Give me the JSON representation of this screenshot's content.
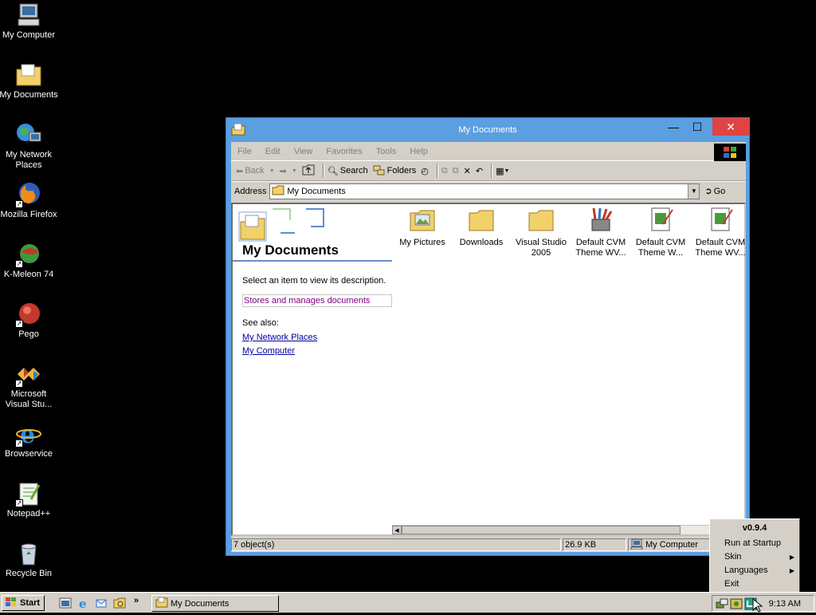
{
  "desktop": {
    "icons": [
      {
        "label": "My Computer",
        "icon": "computer-icon"
      },
      {
        "label": "My Documents",
        "icon": "documents-folder-icon"
      },
      {
        "label": "My Network\nPlaces",
        "icon": "network-places-icon"
      },
      {
        "label": "Mozilla Firefox",
        "icon": "firefox-icon"
      },
      {
        "label": "K-Meleon 74",
        "icon": "kmeleon-icon"
      },
      {
        "label": "Pego",
        "icon": "pego-icon"
      },
      {
        "label": "Microsoft\nVisual Stu...",
        "icon": "visual-studio-icon"
      },
      {
        "label": "Browservice",
        "icon": "internet-explorer-icon"
      },
      {
        "label": "Notepad++",
        "icon": "notepadpp-icon"
      },
      {
        "label": "Recycle Bin",
        "icon": "recycle-bin-icon"
      }
    ]
  },
  "window": {
    "title": "My Documents",
    "menus": [
      "File",
      "Edit",
      "View",
      "Favorites",
      "Tools",
      "Help"
    ],
    "toolbar": {
      "back": "Back",
      "search": "Search",
      "folders": "Folders"
    },
    "address": {
      "label": "Address",
      "value": "My Documents",
      "go": "Go"
    },
    "webview": {
      "title": "My Documents",
      "description": "Select an item to view its description.",
      "info": "Stores and manages documents",
      "see_also": "See also:",
      "links": [
        "My Network Places",
        "My Computer"
      ]
    },
    "files": [
      {
        "name": "My Pictures",
        "icon": "pictures-folder-icon"
      },
      {
        "name": "Downloads",
        "icon": "folder-icon"
      },
      {
        "name": "Visual Studio\n2005",
        "icon": "folder-icon"
      },
      {
        "name": "Default CVM\nTheme WV...",
        "icon": "paint-brushes-icon"
      },
      {
        "name": "Default CVM\nTheme W...",
        "icon": "theme-file-icon"
      },
      {
        "name": "Default CVM\nTheme WV...",
        "icon": "theme-file-icon"
      }
    ],
    "status": {
      "objects": "7 object(s)",
      "size": "26.9 KB",
      "location": "My Computer"
    }
  },
  "taskbar": {
    "start": "Start",
    "task": "My Documents",
    "chevron": "»",
    "clock": "9:13 AM"
  },
  "context_menu": {
    "header": "v0.9.4",
    "items": [
      {
        "label": "Run at Startup",
        "submenu": false
      },
      {
        "label": "Skin",
        "submenu": true
      },
      {
        "label": "Languages",
        "submenu": true
      },
      {
        "label": "Exit",
        "submenu": false
      }
    ]
  },
  "colors": {
    "desktop": "#000000",
    "window_frame": "#5b9fe0",
    "close_button": "#e04343",
    "face": "#d4d0c8",
    "link": "#0000a0"
  }
}
